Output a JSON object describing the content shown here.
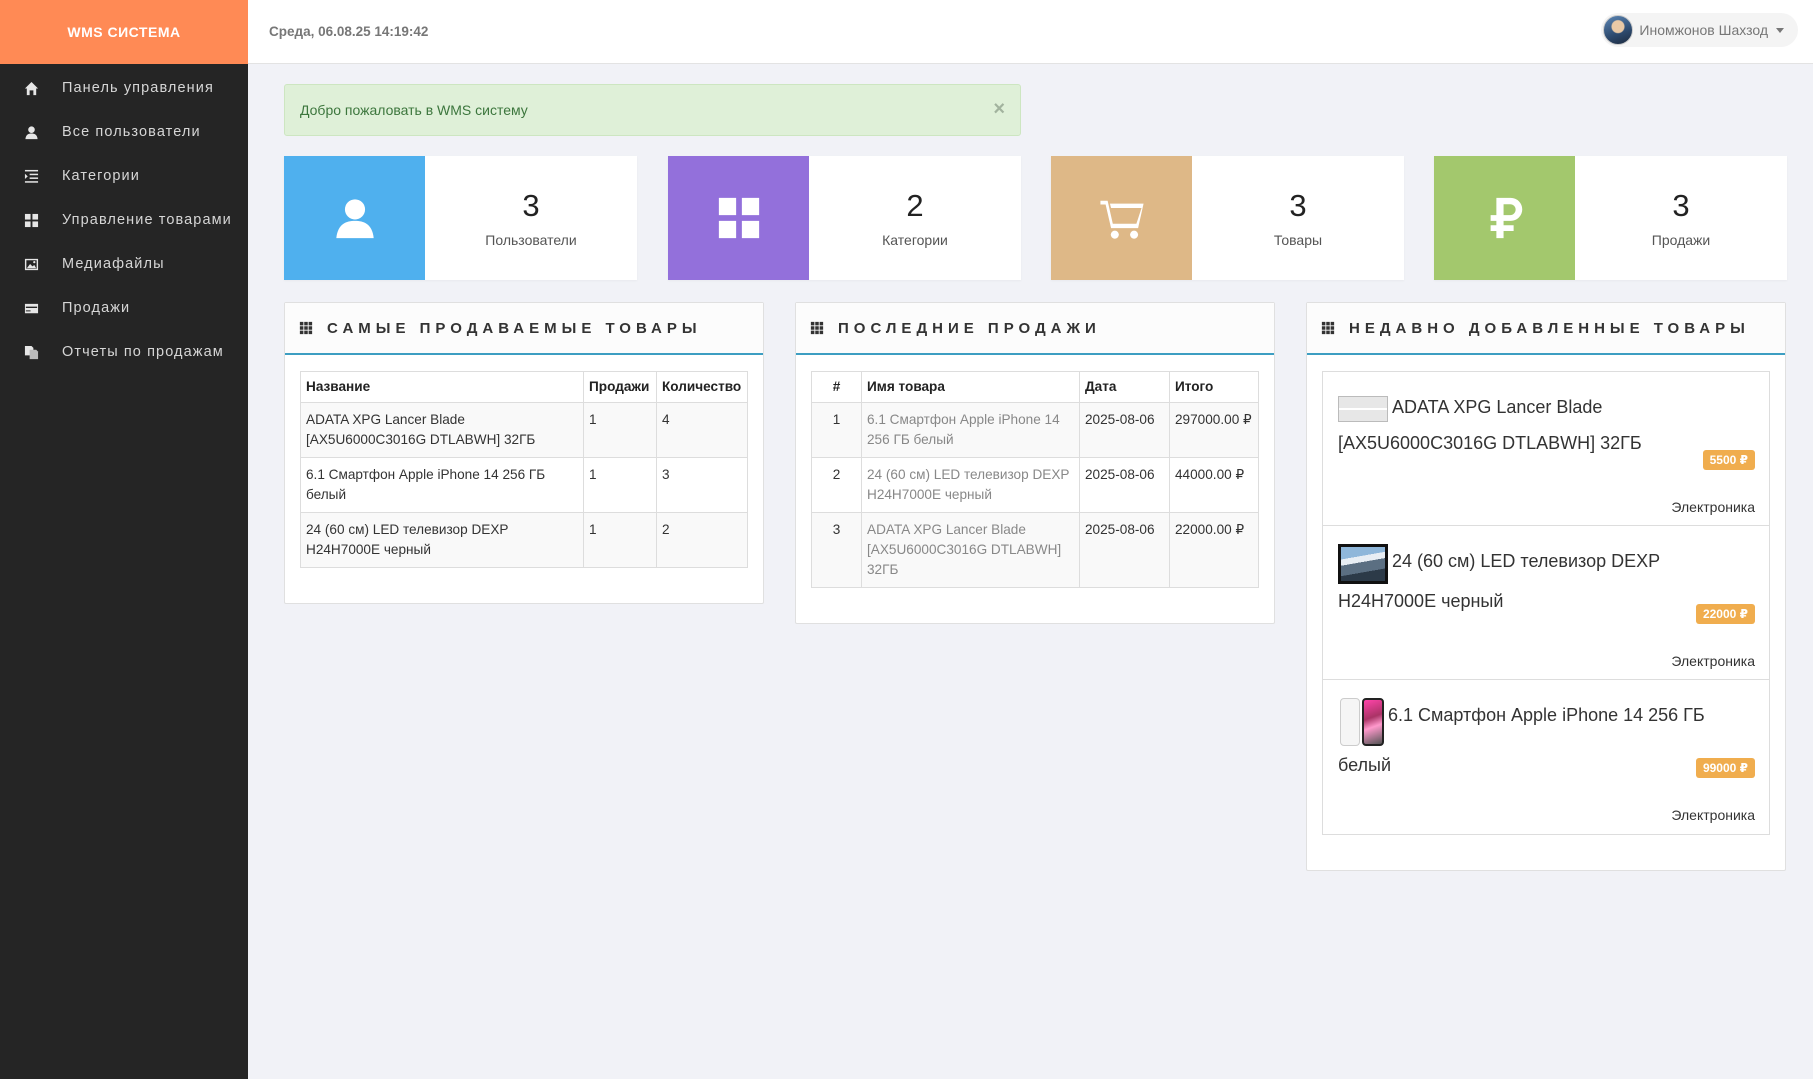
{
  "brand": "WMS СИСТЕМА",
  "header": {
    "datetime": "Среда, 06.08.25 14:19:42",
    "user_name": "Иномжонов Шахзод"
  },
  "sidebar": {
    "items": [
      {
        "label": "Панель управления",
        "icon": "home-icon"
      },
      {
        "label": "Все пользователи",
        "icon": "user-icon"
      },
      {
        "label": "Категории",
        "icon": "indent-icon"
      },
      {
        "label": "Управление товарами",
        "icon": "th-large-icon"
      },
      {
        "label": "Медиафайлы",
        "icon": "picture-icon"
      },
      {
        "label": "Продажи",
        "icon": "credit-card-icon"
      },
      {
        "label": "Отчеты по продажам",
        "icon": "duplicate-icon"
      }
    ]
  },
  "alert": {
    "message": "Добро пожаловать в WMS систему",
    "close": "×"
  },
  "stats": [
    {
      "value": "3",
      "label": "Пользователи",
      "color": "#4fb0ee",
      "icon": "user-icon"
    },
    {
      "value": "2",
      "label": "Категории",
      "color": "#9370db",
      "icon": "th-large-icon"
    },
    {
      "value": "3",
      "label": "Товары",
      "color": "#deb887",
      "icon": "cart-icon"
    },
    {
      "value": "3",
      "label": "Продажи",
      "color": "#a3c86d",
      "icon": "ruble-icon"
    }
  ],
  "best_sellers": {
    "title": "САМЫЕ ПРОДАВАЕМЫЕ ТОВАРЫ",
    "columns": [
      "Название",
      "Продажи",
      "Количество"
    ],
    "rows": [
      {
        "name": "ADATA XPG Lancer Blade [AX5U6000C3016G DTLABWH] 32ГБ",
        "sales": "1",
        "qty": "4"
      },
      {
        "name": "6.1 Смартфон Apple iPhone 14 256 ГБ белый",
        "sales": "1",
        "qty": "3"
      },
      {
        "name": "24 (60 см) LED телевизор DEXP H24H7000E черный",
        "sales": "1",
        "qty": "2"
      }
    ]
  },
  "last_sales": {
    "title": "ПОСЛЕДНИЕ ПРОДАЖИ",
    "columns": [
      "#",
      "Имя товара",
      "Дата",
      "Итого"
    ],
    "rows": [
      {
        "n": "1",
        "name": "6.1 Смартфон Apple iPhone 14 256 ГБ белый",
        "date": "2025-08-06",
        "total": "297000.00 ₽"
      },
      {
        "n": "2",
        "name": "24 (60 см) LED телевизор DEXP H24H7000E черный",
        "date": "2025-08-06",
        "total": "44000.00 ₽"
      },
      {
        "n": "3",
        "name": "ADATA XPG Lancer Blade [AX5U6000C3016G DTLABWH] 32ГБ",
        "date": "2025-08-06",
        "total": "22000.00 ₽"
      }
    ]
  },
  "recent_products": {
    "title": "НЕДАВНО ДОБАВЛЕННЫЕ ТОВАРЫ",
    "items": [
      {
        "name": "ADATA XPG Lancer Blade [AX5U6000C3016G DTLABWH] 32ГБ",
        "price": "5500 ₽",
        "category": "Электроника"
      },
      {
        "name": "24 (60 см) LED телевизор DEXP H24H7000E черный",
        "price": "22000 ₽",
        "category": "Электроника"
      },
      {
        "name": "6.1 Смартфон Apple iPhone 14 256 ГБ белый",
        "price": "99000 ₽",
        "category": "Электроника"
      }
    ]
  }
}
